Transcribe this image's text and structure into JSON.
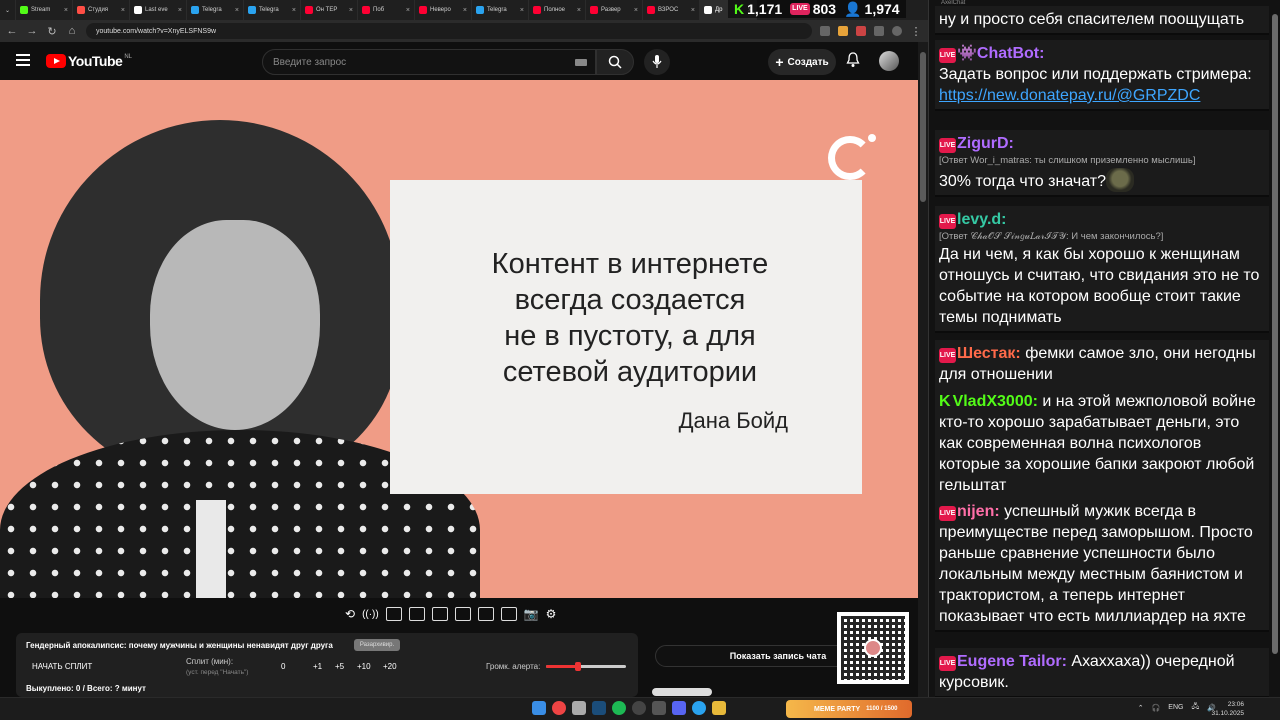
{
  "browser": {
    "tabs": [
      {
        "label": "Stream",
        "color": "#53fc18"
      },
      {
        "label": "Студия",
        "color": "#ff4e45"
      },
      {
        "label": "Last eve",
        "color": "#ffffff"
      },
      {
        "label": "Telegra",
        "color": "#2aa3ef"
      },
      {
        "label": "Telegra",
        "color": "#2aa3ef"
      },
      {
        "label": "Он ТЕР",
        "color": "#ff0033"
      },
      {
        "label": "Поб",
        "color": "#ff0033"
      },
      {
        "label": "Неверо",
        "color": "#ff0033"
      },
      {
        "label": "Telegra",
        "color": "#2aa3ef"
      },
      {
        "label": "Полное",
        "color": "#ff0033"
      },
      {
        "label": "Развер",
        "color": "#ff0033"
      },
      {
        "label": "ВЗРОС",
        "color": "#ff0033"
      },
      {
        "label": "Др",
        "color": "#ffffff"
      }
    ],
    "url": "youtube.com/watch?v=XnyELSFNS9w"
  },
  "stream_counters": {
    "kick": "1,171",
    "youtube": "803",
    "viewers": "1,974",
    "live_badge": "LIVE"
  },
  "youtube": {
    "logo_word": "YouTube",
    "logo_country": "NL",
    "search_placeholder": "Введите запрос",
    "create_label": "Создать"
  },
  "video": {
    "quote": "Контент в интернете всегда создается не в пустоту, а для сетевой аудитории",
    "quote_lines": [
      "Контент в интернете",
      "всегда создается",
      "не в пустоту, а для",
      "сетевой аудитории"
    ],
    "author": "Дана Бойд"
  },
  "split_panel": {
    "title": "Гендерный апокалипсис: почему мужчины и женщины ненавидят друг друга",
    "small_btn": "Разархивир.",
    "start": "НАЧАТЬ СПЛИТ",
    "label": "Сплит (мин):",
    "sub": "(уст. перед \"Начать\")",
    "value": "0",
    "steps": [
      "+1",
      "+5",
      "+10",
      "+20"
    ],
    "volume_label": "Громк. алерта:",
    "volume_level": 0.4,
    "bought": "Выкуплено: 0 / Всего: ? минут"
  },
  "show_chat": "Показать запись чата",
  "chat": {
    "window_title": "AxelChat",
    "live_badge": "LIVE",
    "messages": [
      {
        "platform": "none",
        "user": "",
        "color": "#ffffff",
        "reply": "",
        "text": "ну и просто себя спасителем поощущать"
      },
      {
        "platform": "live",
        "user": "👾ChatBot:",
        "color": "#b06cff",
        "reply": "",
        "text": "Задать вопрос или поддержать стримера:",
        "link": "https://new.donatepay.ru/@GRPZDC"
      },
      {
        "platform": "live",
        "user": "ZigurD:",
        "color": "#b06cff",
        "reply": "[Ответ Wor_i_matras: ты слишком приземленно мыслишь]",
        "text": "30% тогда что значат?"
      },
      {
        "platform": "live",
        "user": "levy.d:",
        "color": "#35c9a4",
        "reply": "[Ответ 𝒞𝒽𝒶𝒪𝒮 𝒮𝒾𝓃𝑔𝓊𝐿𝒶𝓇ℐ𝒯𝒴: И чем закончилось?]",
        "text": "Да ни чем, я как бы хорошо к женщинам отношусь и считаю, что свидания это не то событие на котором вообще стоит такие темы поднимать"
      },
      {
        "platform": "live",
        "user": "Шестак:",
        "color": "#ff6a4a",
        "reply": "",
        "text": "фемки самое зло, они негодны для отношении"
      },
      {
        "platform": "kick",
        "user": "VladX3000:",
        "color": "#53fc18",
        "reply": "",
        "text": "и на этой межполовой войне кто-то хорошо зарабатывает деньги, это как современная волна психологов которые за хорошие бапки закроют любой гельштат"
      },
      {
        "platform": "live",
        "user": "nijen:",
        "color": "#ff6fa8",
        "reply": "",
        "text": "успешный мужик всегда в преимуществе перед заморышом. Просто раньше сравнение успешности было локальным между местным баянистом и трактористом, а теперь интернет показывает что есть миллиардер на яхте"
      },
      {
        "platform": "live",
        "user": "Eugene Tailor:",
        "color": "#b06cff",
        "reply": "",
        "text": "Ахаххаха)) очередной курсовик."
      }
    ]
  },
  "taskbar": {
    "meme_party": "MEME PARTY",
    "meme_progress": "1100 / 1500",
    "lang": "ENG",
    "time": "23:06",
    "date": "31.10.2025"
  }
}
